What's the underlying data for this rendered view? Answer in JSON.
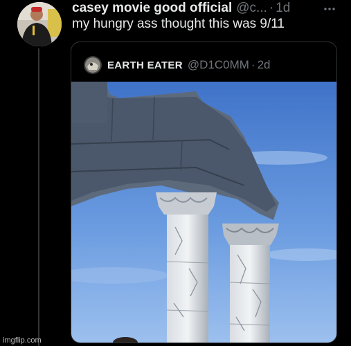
{
  "tweet": {
    "author_name": "casey movie good official",
    "author_handle": "@c...",
    "separator": "·",
    "time": "1d",
    "text": "my hungry ass thought this was 9/11",
    "more_icon": "more-horizontal-icon"
  },
  "quoted_tweet": {
    "author_name": "EARTH EATER",
    "author_handle": "@D1C0MM",
    "separator": "·",
    "time": "2d",
    "media_alt": "photo of ruined stone columns against blue sky"
  },
  "watermark": "imgflip.com",
  "colors": {
    "background": "#000000",
    "primary_text": "#e7e9ea",
    "secondary_text": "#71767b",
    "border": "#2f3336",
    "sky": "#4a7fd0"
  }
}
